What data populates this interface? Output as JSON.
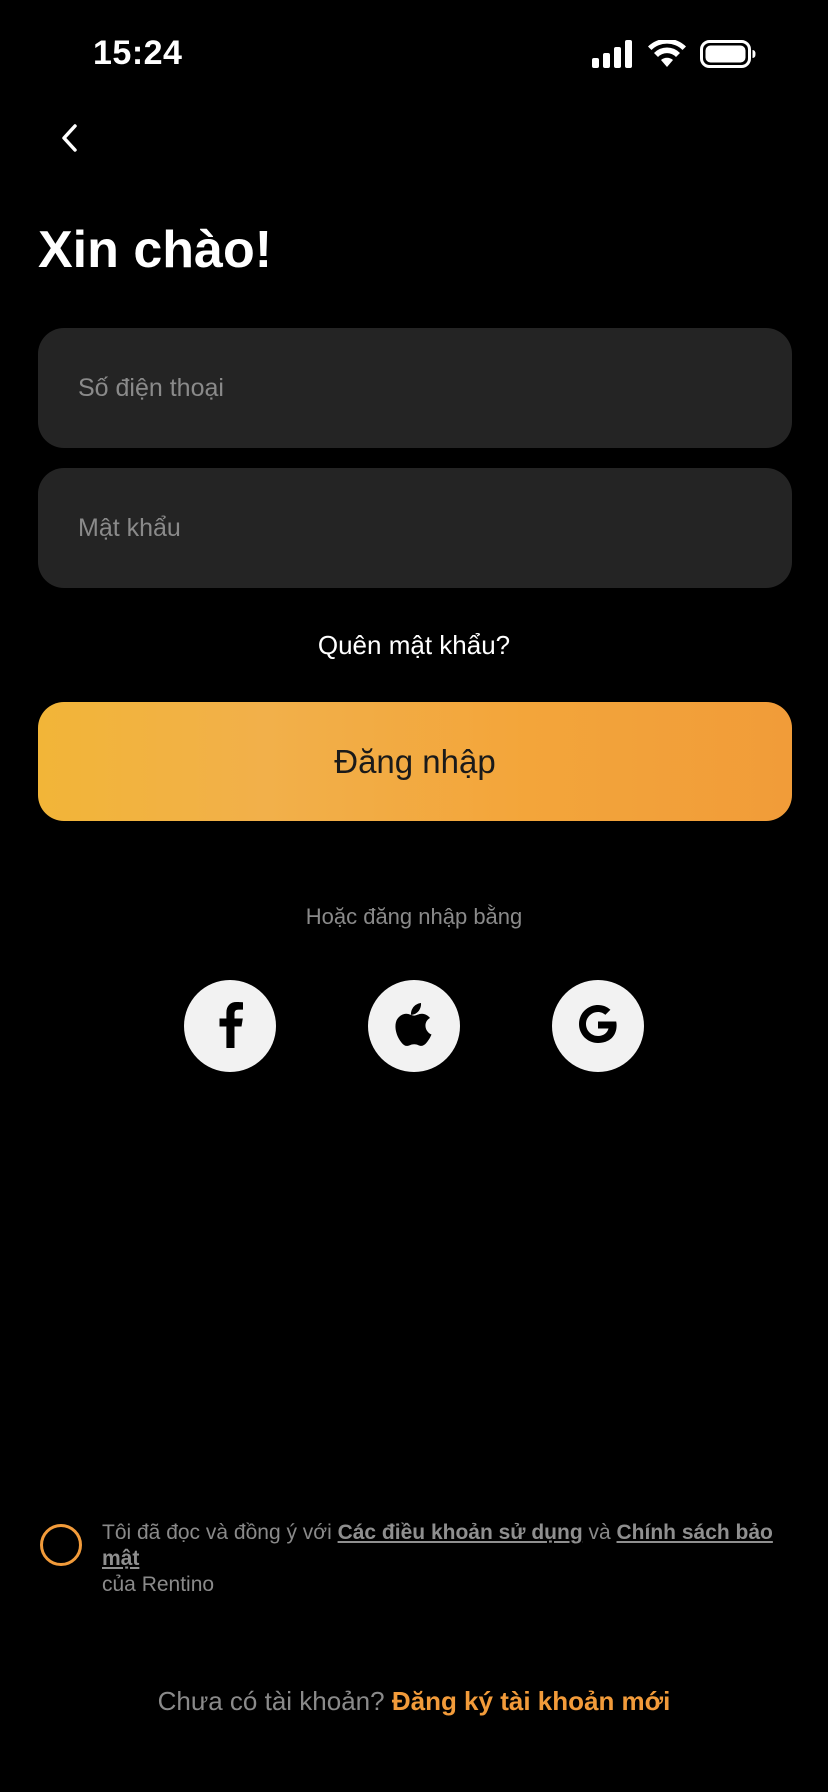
{
  "status_bar": {
    "time": "15:24"
  },
  "header": {
    "title": "Xin chào!"
  },
  "form": {
    "phone_placeholder": "Số điện thoại",
    "password_placeholder": "Mật khẩu",
    "forgot_password": "Quên mật khẩu?",
    "login_label": "Đăng nhập"
  },
  "social": {
    "label": "Hoặc đăng nhập bằng",
    "providers": [
      "facebook-icon",
      "apple-icon",
      "google-icon"
    ]
  },
  "terms": {
    "prefix": "Tôi đã đọc và đồng ý với ",
    "terms_link": "Các điều khoản sử dụng",
    "and": " và ",
    "privacy_link": "Chính sách bảo mật",
    "suffix": " của Rentino"
  },
  "signup": {
    "prompt": "Chưa có tài khoản? ",
    "link": "Đăng ký tài khoản mới"
  },
  "colors": {
    "background": "#000000",
    "input_background": "#242424",
    "accent": "#f29b3a",
    "login_gradient_start": "#f2b538",
    "login_gradient_end": "#f19c39"
  }
}
